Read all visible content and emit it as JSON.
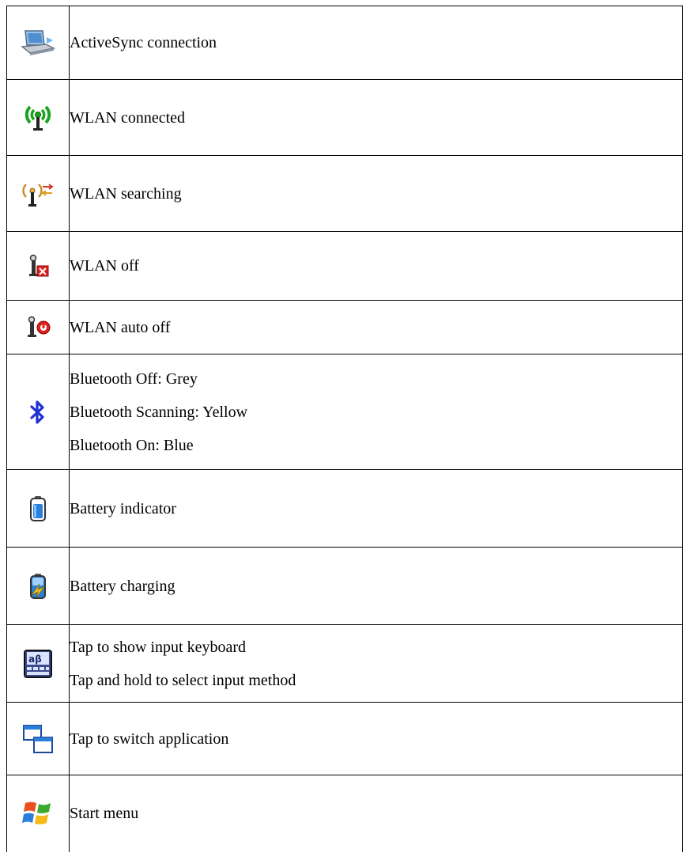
{
  "rows": [
    {
      "icon": "laptop-sync-icon",
      "lines": [
        "ActiveSync connection"
      ]
    },
    {
      "icon": "wlan-connected-icon",
      "lines": [
        "WLAN connected"
      ]
    },
    {
      "icon": "wlan-searching-icon",
      "lines": [
        "WLAN searching"
      ]
    },
    {
      "icon": "wlan-off-icon",
      "lines": [
        "WLAN off"
      ]
    },
    {
      "icon": "wlan-auto-off-icon",
      "lines": [
        "WLAN auto off"
      ]
    },
    {
      "icon": "bluetooth-icon",
      "lines": [
        "Bluetooth Off: Grey",
        "Bluetooth Scanning: Yellow",
        "Bluetooth On: Blue"
      ]
    },
    {
      "icon": "battery-icon",
      "lines": [
        "Battery indicator"
      ]
    },
    {
      "icon": "battery-charging-icon",
      "lines": [
        "Battery charging"
      ]
    },
    {
      "icon": "keyboard-input-icon",
      "lines": [
        "Tap to show input keyboard",
        "Tap and hold to select input method"
      ]
    },
    {
      "icon": "switch-application-icon",
      "lines": [
        "Tap to switch application"
      ]
    },
    {
      "icon": "windows-start-icon",
      "lines": [
        "Start menu"
      ]
    }
  ],
  "colors": {
    "border": "#000000",
    "wlan_green": "#1ca31c",
    "bluetooth_blue": "#1f2fd6",
    "error_red": "#e02020",
    "window_blue": "#2a7fd8"
  }
}
